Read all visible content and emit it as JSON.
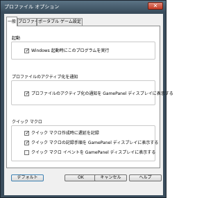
{
  "window": {
    "title": "プロファイル オプション",
    "close_glyph": "✕"
  },
  "tabs": [
    {
      "label": "一般",
      "active": true
    },
    {
      "label": "プロファイル",
      "active": false
    },
    {
      "label": "ポータブル ゲーム設定",
      "active": false
    }
  ],
  "groups": {
    "startup": {
      "title": "起動",
      "options": [
        {
          "label": "Windows 起動時にこのプログラムを実行",
          "checked": true
        }
      ]
    },
    "profile_notify": {
      "title": "プロファイルのアクティブ化を通知",
      "options": [
        {
          "label": "プロファイルのアクティブ化の通知を GamePanel ディスプレイに表示する",
          "checked": true
        }
      ]
    },
    "quick_macro": {
      "title": "クイック マクロ",
      "options": [
        {
          "label": "クイック マクロ作成時に遅延を記録",
          "checked": true
        },
        {
          "label": "クイック マクロの記録手順を GamePanel ディスプレイに表示する",
          "checked": true
        },
        {
          "label": "クイック マクロ イベントを GamePanel ディスプレイに表示する",
          "checked": false
        }
      ]
    }
  },
  "buttons": {
    "default": "デフォルト",
    "ok": "OK",
    "cancel": "キャンセル",
    "help": "ヘルプ"
  },
  "check_glyph": "✓"
}
